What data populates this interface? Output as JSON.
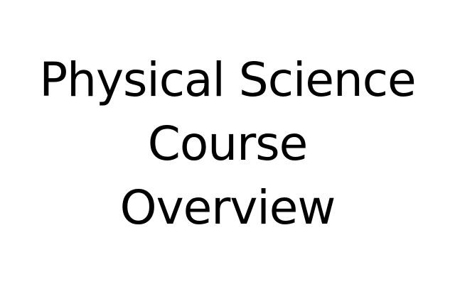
{
  "slide": {
    "title_lines": [
      "Physical Science",
      "Course",
      "Overview"
    ]
  }
}
